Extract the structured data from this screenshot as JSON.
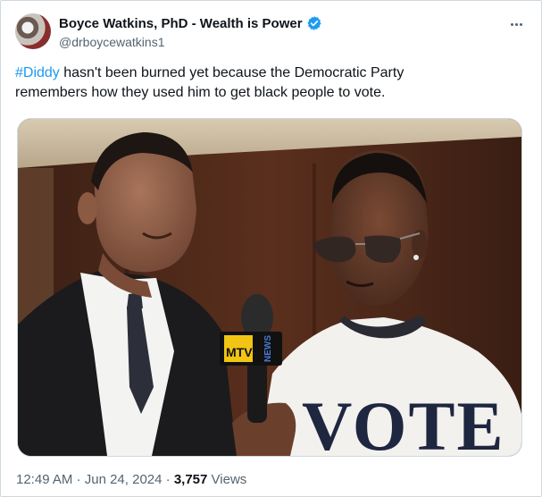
{
  "author": {
    "display_name": "Boyce Watkins, PhD - Wealth is Power",
    "handle": "@drboycewatkins1",
    "verified_icon": "verified-badge-icon",
    "more_icon": "more-horizontal-icon"
  },
  "tweet": {
    "hashtag": "#Diddy",
    "text_line1_rest": " hasn't been burned yet because the Democratic Party",
    "text_line2": "remembers how they used him to get black people to vote."
  },
  "media": {
    "shirt_text": "VOTE",
    "mic_flag_logo": "MTV",
    "mic_flag_side": "NEWS"
  },
  "meta": {
    "time": "12:49 AM",
    "sep1": " · ",
    "date": "Jun 24, 2024",
    "sep2": " · ",
    "views_count": "3,757",
    "views_label": " Views"
  },
  "colors": {
    "link": "#1d9bf0",
    "secondary_text": "#536471",
    "border": "#cfd9de"
  }
}
